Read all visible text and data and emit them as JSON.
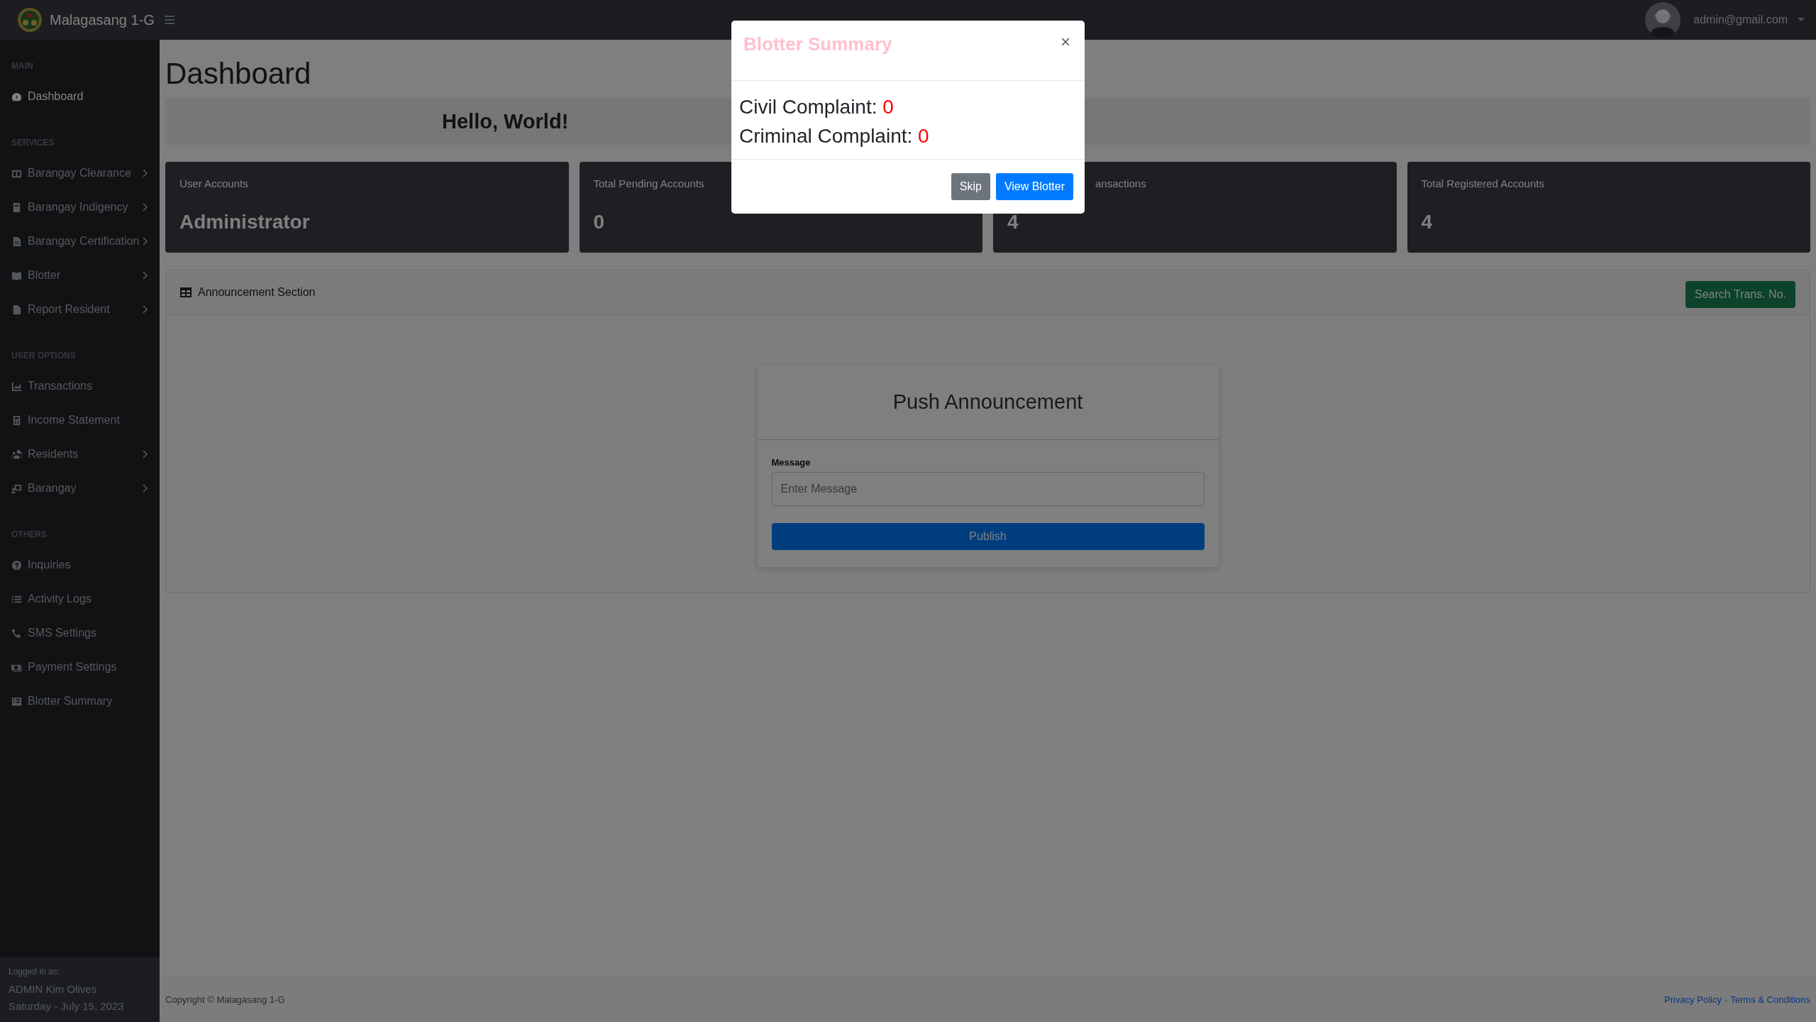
{
  "topbar": {
    "brand": "Malagasang 1-G",
    "user_email": "admin@gmail.com"
  },
  "sidebar": {
    "sections": [
      {
        "title": "MAIN",
        "items": [
          {
            "label": "Dashboard",
            "selected": true,
            "expandable": false
          }
        ]
      },
      {
        "title": "SERVICES",
        "items": [
          {
            "label": "Barangay Clearance",
            "selected": false,
            "expandable": true
          },
          {
            "label": "Barangay Indigency",
            "selected": false,
            "expandable": true
          },
          {
            "label": "Barangay Certification",
            "selected": false,
            "expandable": true
          },
          {
            "label": "Blotter",
            "selected": false,
            "expandable": true
          },
          {
            "label": "Report Resident",
            "selected": false,
            "expandable": true
          }
        ]
      },
      {
        "title": "USER OPTIONS",
        "items": [
          {
            "label": "Transactions",
            "selected": false,
            "expandable": false
          },
          {
            "label": "Income Statement",
            "selected": false,
            "expandable": false
          },
          {
            "label": "Residents",
            "selected": false,
            "expandable": true
          },
          {
            "label": "Barangay",
            "selected": false,
            "expandable": true
          }
        ]
      },
      {
        "title": "OTHERS",
        "items": [
          {
            "label": "Inquiries",
            "selected": false,
            "expandable": false
          },
          {
            "label": "Activity Logs",
            "selected": false,
            "expandable": false
          },
          {
            "label": "SMS Settings",
            "selected": false,
            "expandable": false
          },
          {
            "label": "Payment Settings",
            "selected": false,
            "expandable": false
          },
          {
            "label": "Blotter Summary",
            "selected": false,
            "expandable": false
          }
        ]
      }
    ],
    "footer": {
      "label": "Logged in as:",
      "name": "ADMIN Kim Olives",
      "date": "Saturday - July 15, 2023"
    }
  },
  "page": {
    "title": "Dashboard",
    "greeting": "Hello, World!",
    "stat_cards": [
      {
        "title": "User Accounts",
        "value": "Administrator"
      },
      {
        "title": "Total Pending Accounts",
        "value": "0"
      },
      {
        "title": "ansactions",
        "value": "4"
      },
      {
        "title": "Total Registered Accounts",
        "value": "4"
      }
    ],
    "announcement": {
      "section_title": "Announcement Section",
      "search_button": "Search Trans. No.",
      "form_title": "Push Announcement",
      "message_label": "Message",
      "message_placeholder": "Enter Message",
      "publish_button": "Publish"
    }
  },
  "footer": {
    "copyright": "Copyright © Malagasang 1-G",
    "links": [
      "Privacy Policy",
      "Terms & Conditions"
    ],
    "separator": "·"
  },
  "modal": {
    "title": "Blotter Summary",
    "close": "×",
    "lines": [
      {
        "label": "Civil Complaint:",
        "value": "0"
      },
      {
        "label": "Criminal Complaint:",
        "value": "0"
      }
    ],
    "buttons": [
      {
        "label": "Skip",
        "kind": "secondary"
      },
      {
        "label": "View Blotter",
        "kind": "primary"
      }
    ]
  }
}
